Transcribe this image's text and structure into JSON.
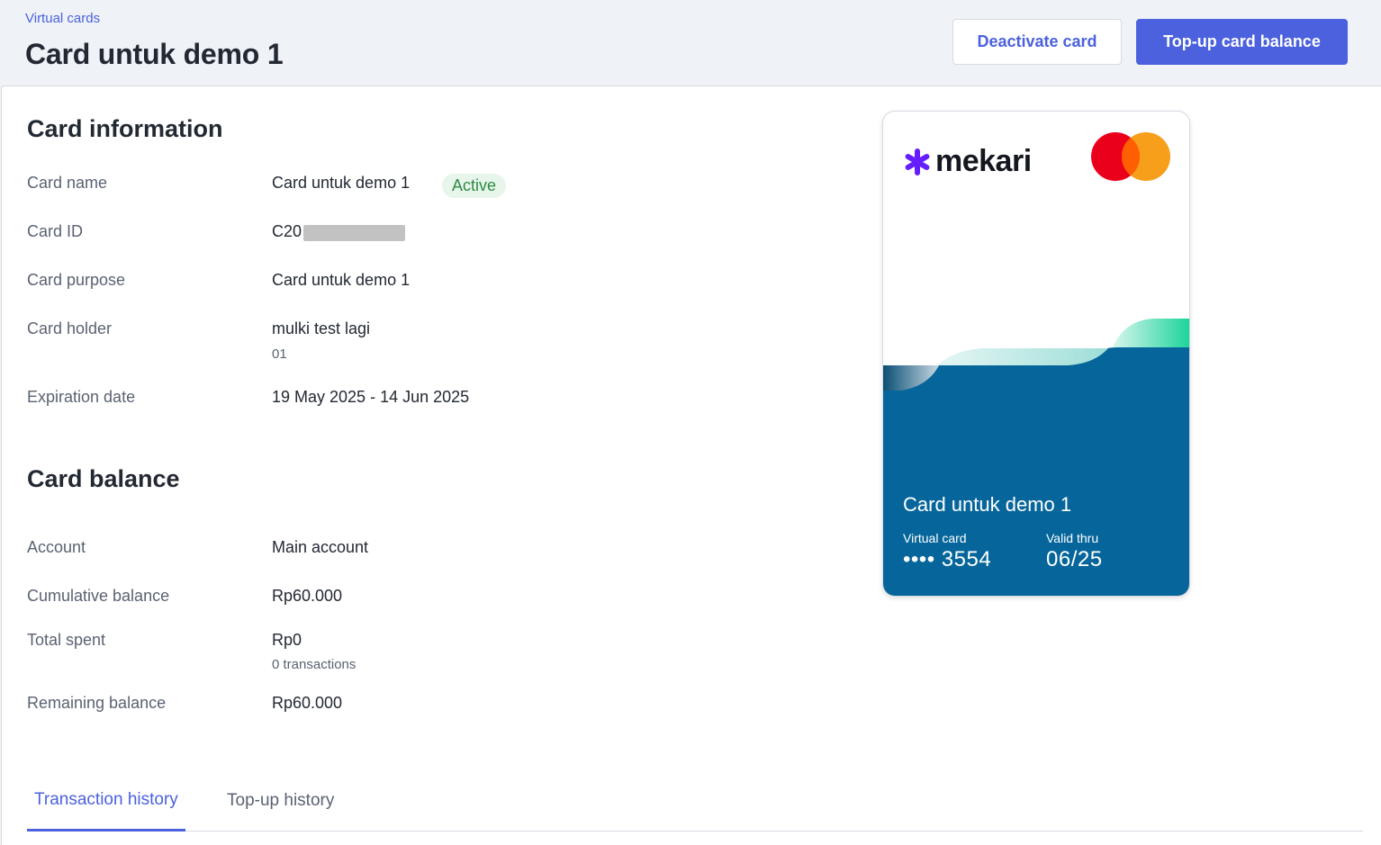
{
  "header": {
    "breadcrumb": "Virtual cards",
    "title": "Card untuk demo 1",
    "deactivate_label": "Deactivate card",
    "topup_label": "Top-up card balance"
  },
  "card_information": {
    "title": "Card information",
    "rows": [
      {
        "label": "Card name",
        "value": "Card untuk demo 1",
        "badge": "Active"
      },
      {
        "label": "Card ID",
        "value": "C20"
      },
      {
        "label": "Card purpose",
        "value": "Card untuk demo 1"
      },
      {
        "label": "Card holder",
        "value": "mulki test lagi",
        "sub": "01"
      },
      {
        "label": "Expiration date",
        "value": "19 May 2025 - 14 Jun 2025"
      }
    ]
  },
  "card_balance": {
    "title": "Card balance",
    "rows": [
      {
        "label": "Account",
        "value": "Main account"
      },
      {
        "label": "Cumulative balance",
        "value": "Rp60.000"
      },
      {
        "label": "Total spent",
        "value": "Rp0",
        "sub": "0 transactions"
      },
      {
        "label": "Remaining balance",
        "value": "Rp60.000"
      }
    ]
  },
  "tabs": [
    {
      "label": "Transaction history",
      "active": true
    },
    {
      "label": "Top-up history",
      "active": false
    }
  ],
  "card_visual": {
    "brand": "mekari",
    "network_icon": "mastercard-icon",
    "name": "Card untuk demo 1",
    "type_label": "Virtual card",
    "masked_number": "•••• 3554",
    "valid_label": "Valid thru",
    "valid_value": "06/25"
  },
  "colors": {
    "accent": "#4b61dd",
    "card_blue": "#06669b",
    "active_badge_bg": "#e7f5ea",
    "active_badge_text": "#2e8b45",
    "mekari_purple": "#651fff"
  }
}
